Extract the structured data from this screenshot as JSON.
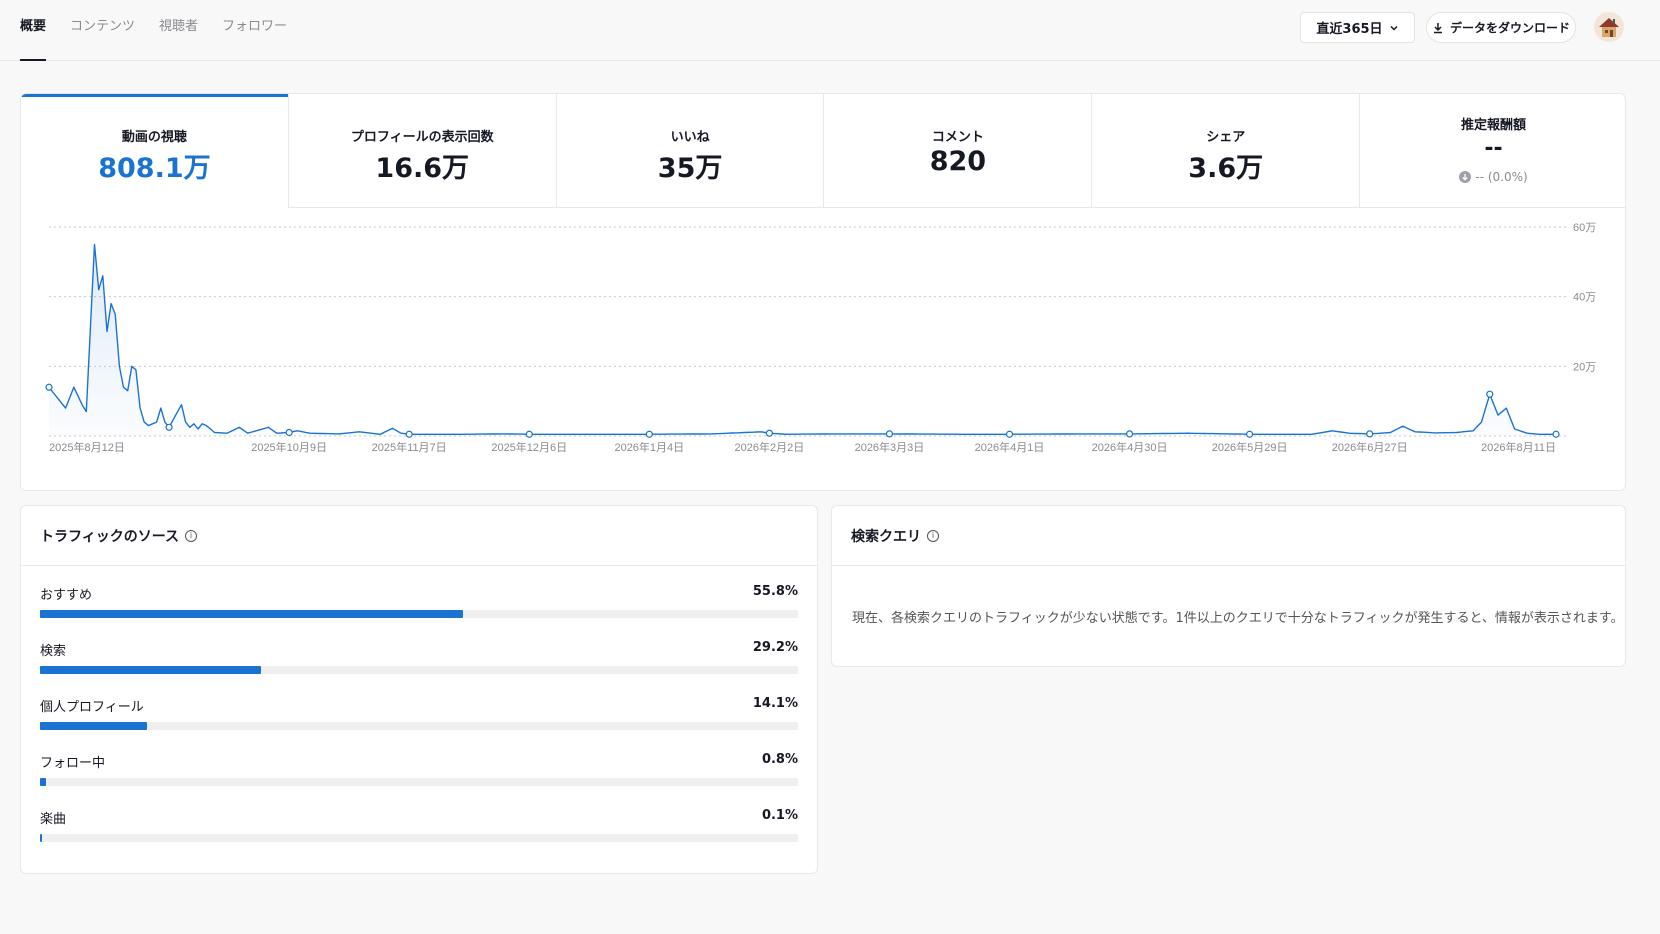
{
  "nav": {
    "tabs": [
      "概要",
      "コンテンツ",
      "視聴者",
      "フォロワー"
    ],
    "active_tab": 0,
    "period_label": "直近365日",
    "download_label": "データをダウンロード"
  },
  "metrics": [
    {
      "label": "動画の視聴",
      "value": "808.1万"
    },
    {
      "label": "プロフィールの表示回数",
      "value": "16.6万"
    },
    {
      "label": "いいね",
      "value": "35万"
    },
    {
      "label": "コメント",
      "value": "820"
    },
    {
      "label": "シェア",
      "value": "3.6万"
    },
    {
      "label": "推定報酬額",
      "value": "--",
      "sub": "-- (0.0%)"
    }
  ],
  "chart_data": {
    "type": "area",
    "ylim": [
      0,
      600000
    ],
    "yticks": [
      200000,
      400000,
      600000
    ],
    "ytick_labels": [
      "20万",
      "40万",
      "60万"
    ],
    "x_tick_labels": [
      "2025年8月12日",
      "2025年10月9日",
      "2025年11月7日",
      "2025年12月6日",
      "2026年1月4日",
      "2026年2月2日",
      "2026年3月3日",
      "2026年4月1日",
      "2026年4月30日",
      "2026年5月29日",
      "2026年6月27日",
      "2026年8月11日"
    ],
    "x_tick_days": [
      0,
      58,
      87,
      116,
      145,
      174,
      203,
      232,
      261,
      290,
      319,
      364
    ],
    "marker_days": [
      0,
      29,
      58,
      87,
      116,
      145,
      174,
      203,
      232,
      261,
      290,
      319,
      348,
      364
    ],
    "days": 365,
    "keypoints": [
      [
        0,
        140000
      ],
      [
        2,
        110000
      ],
      [
        4,
        80000
      ],
      [
        6,
        140000
      ],
      [
        8,
        90000
      ],
      [
        9,
        70000
      ],
      [
        11,
        550000
      ],
      [
        12,
        420000
      ],
      [
        13,
        460000
      ],
      [
        14,
        300000
      ],
      [
        15,
        380000
      ],
      [
        16,
        350000
      ],
      [
        17,
        200000
      ],
      [
        18,
        140000
      ],
      [
        19,
        130000
      ],
      [
        20,
        200000
      ],
      [
        21,
        190000
      ],
      [
        22,
        80000
      ],
      [
        23,
        40000
      ],
      [
        24,
        30000
      ],
      [
        26,
        40000
      ],
      [
        27,
        80000
      ],
      [
        28,
        40000
      ],
      [
        29,
        25000
      ],
      [
        32,
        90000
      ],
      [
        33,
        40000
      ],
      [
        34,
        25000
      ],
      [
        35,
        35000
      ],
      [
        36,
        20000
      ],
      [
        37,
        35000
      ],
      [
        38,
        30000
      ],
      [
        40,
        10000
      ],
      [
        43,
        8000
      ],
      [
        46,
        25000
      ],
      [
        48,
        8000
      ],
      [
        53,
        25000
      ],
      [
        55,
        8000
      ],
      [
        58,
        10000
      ],
      [
        60,
        15000
      ],
      [
        63,
        8000
      ],
      [
        70,
        6000
      ],
      [
        75,
        12000
      ],
      [
        80,
        5000
      ],
      [
        83,
        22000
      ],
      [
        85,
        8000
      ],
      [
        87,
        5000
      ],
      [
        100,
        5000
      ],
      [
        110,
        6000
      ],
      [
        116,
        5000
      ],
      [
        130,
        5000
      ],
      [
        145,
        5000
      ],
      [
        160,
        6000
      ],
      [
        172,
        12000
      ],
      [
        174,
        8000
      ],
      [
        178,
        5000
      ],
      [
        190,
        6000
      ],
      [
        203,
        6000
      ],
      [
        220,
        5000
      ],
      [
        232,
        5000
      ],
      [
        250,
        6000
      ],
      [
        261,
        6000
      ],
      [
        275,
        8000
      ],
      [
        290,
        5000
      ],
      [
        305,
        5000
      ],
      [
        310,
        15000
      ],
      [
        314,
        8000
      ],
      [
        319,
        6000
      ],
      [
        324,
        10000
      ],
      [
        327,
        28000
      ],
      [
        330,
        12000
      ],
      [
        335,
        9000
      ],
      [
        340,
        10000
      ],
      [
        344,
        15000
      ],
      [
        346,
        40000
      ],
      [
        348,
        120000
      ],
      [
        350,
        60000
      ],
      [
        352,
        80000
      ],
      [
        354,
        20000
      ],
      [
        357,
        8000
      ],
      [
        360,
        5000
      ],
      [
        364,
        5000
      ]
    ]
  },
  "traffic": {
    "title": "トラフィックのソース",
    "sources": [
      {
        "label": "おすすめ",
        "pct": "55.8%",
        "value": 55.8
      },
      {
        "label": "検索",
        "pct": "29.2%",
        "value": 29.2
      },
      {
        "label": "個人プロフィール",
        "pct": "14.1%",
        "value": 14.1
      },
      {
        "label": "フォロー中",
        "pct": "0.8%",
        "value": 0.8
      },
      {
        "label": "楽曲",
        "pct": "0.1%",
        "value": 0.1
      }
    ]
  },
  "search": {
    "title": "検索クエリ",
    "message": "現在、各検索クエリのトラフィックが少ない状態です。1件以上のクエリで十分なトラフィックが発生すると、情報が表示されます。"
  },
  "colors": {
    "accent": "#1a73d0",
    "text": "#161823",
    "muted": "#8a8b91"
  }
}
